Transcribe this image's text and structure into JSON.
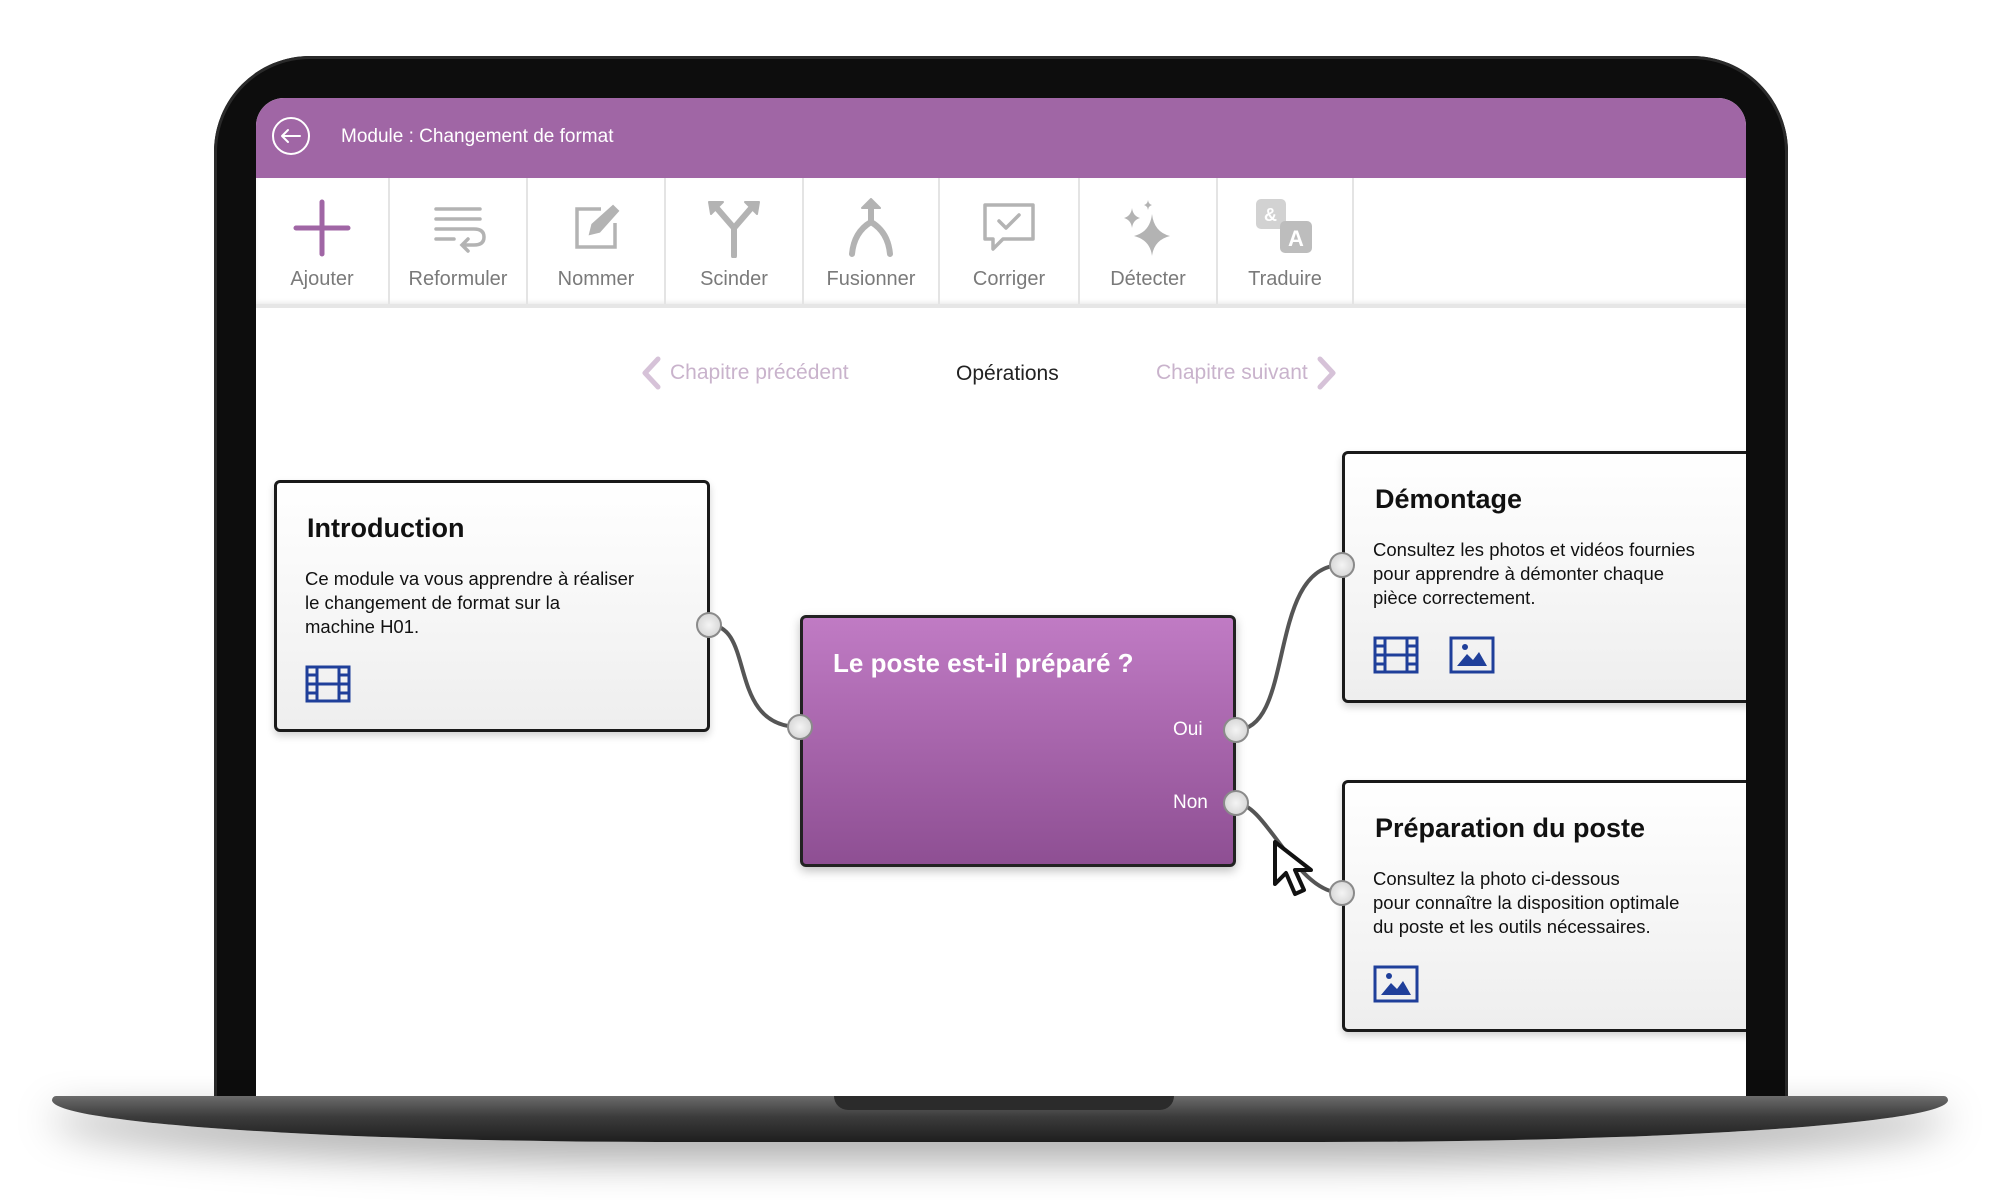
{
  "header": {
    "title": "Module : Changement de format"
  },
  "toolbar": {
    "items": [
      {
        "label": "Ajouter",
        "icon": "plus-icon"
      },
      {
        "label": "Reformuler",
        "icon": "rephrase-icon"
      },
      {
        "label": "Nommer",
        "icon": "edit-icon"
      },
      {
        "label": "Scinder",
        "icon": "split-icon"
      },
      {
        "label": "Fusionner",
        "icon": "merge-icon"
      },
      {
        "label": "Corriger",
        "icon": "check-message-icon"
      },
      {
        "label": "Détecter",
        "icon": "sparkle-icon"
      },
      {
        "label": "Traduire",
        "icon": "translate-icon"
      }
    ]
  },
  "chapter_nav": {
    "prev": "Chapitre précédent",
    "current": "Opérations",
    "next": "Chapitre suivant"
  },
  "nodes": {
    "introduction": {
      "title": "Introduction",
      "lines": [
        "Ce module va vous apprendre à réaliser",
        "le changement de format sur la",
        "machine H01."
      ]
    },
    "decision": {
      "title": "Le poste est-il préparé ?",
      "yes": "Oui",
      "no": "Non"
    },
    "demontage": {
      "title": "Démontage",
      "lines": [
        "Consultez les photos et vidéos fournies",
        "pour apprendre à démonter chaque",
        "pièce correctement."
      ]
    },
    "preparation": {
      "title": "Préparation du poste",
      "lines": [
        "Consultez la photo ci-dessous",
        "pour connaître la disposition optimale",
        "du poste et les outils nécessaires."
      ]
    }
  },
  "colors": {
    "header": "#a066a5",
    "accent": "#a066a5",
    "media_icon": "#1f3f9a",
    "nav_disabled": "#c9b3cc"
  }
}
